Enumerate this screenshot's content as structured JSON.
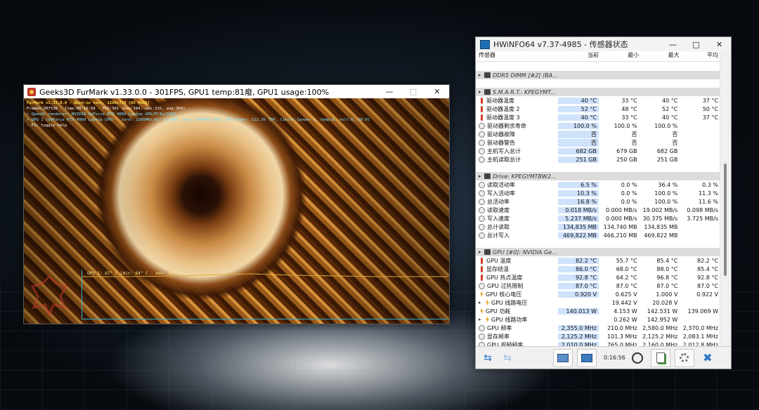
{
  "furmark": {
    "title": "Geeks3D FurMark v1.33.0.0 - 301FPS, GPU1 temp:81癈, GPU1 usage:100%",
    "osd_line1": "FurMark v1.33.0.0 - Burn-in test, 1280x720 (8X MSAA)",
    "osd_line2": "Frames:307538 - time:00:16:58 - FPS:301 (min:194, max:315, avg:304)",
    "osd_line3": "> OpenGL renderer: NVIDIA GeForce RTX 4060 Laptop GPU/PCIe/SSE2",
    "osd_line4": "> GPU 1 (GeForce RTX 4060 Laptop GPU) - core: 2205MHz/81° C/100%, mem: 8000MHz/96%, GPU power: 122.3% TDP, limits:[power:1, temp:0, volt:0, OV:0]",
    "osd_line5": "- F1: toggle help",
    "graph_label": "GPU 1: 81° C (min: 64° C - max: 85° C)"
  },
  "hwinfo": {
    "title": "HWiNFO64 v7.37-4985 - 传感器状态",
    "headers": {
      "sensor": "传感器",
      "current": "当前",
      "min": "最小",
      "max": "最大",
      "avg": "平均"
    },
    "groups": [
      {
        "label": "DDR5 DIMM [#2] (BA...",
        "rows": []
      },
      {
        "label": "S.M.A.R.T.: KPEGYMT...",
        "rows": [
          {
            "icon": "therm",
            "label": "驱动器温度",
            "cur": "40 °C",
            "min": "33 °C",
            "max": "40 °C",
            "avg": "37 °C"
          },
          {
            "icon": "therm",
            "label": "驱动器温度 2",
            "cur": "52 °C",
            "min": "48 °C",
            "max": "52 °C",
            "avg": "50 °C"
          },
          {
            "icon": "therm",
            "label": "驱动器温度 3",
            "cur": "40 °C",
            "min": "33 °C",
            "max": "40 °C",
            "avg": "37 °C"
          },
          {
            "icon": "circ",
            "label": "驱动器剩余寿命",
            "cur": "100.0 %",
            "min": "100.0 %",
            "max": "100.0 %",
            "avg": ""
          },
          {
            "icon": "circ",
            "label": "驱动器故障",
            "cur": "否",
            "min": "否",
            "max": "否",
            "avg": ""
          },
          {
            "icon": "circ",
            "label": "驱动器警告",
            "cur": "否",
            "min": "否",
            "max": "否",
            "avg": ""
          },
          {
            "icon": "circ",
            "label": "主机写入总计",
            "cur": "682 GB",
            "min": "679 GB",
            "max": "682 GB",
            "avg": ""
          },
          {
            "icon": "circ",
            "label": "主机读取总计",
            "cur": "251 GB",
            "min": "250 GB",
            "max": "251 GB",
            "avg": ""
          }
        ]
      },
      {
        "label": "Drive: KPEGYMTBW2...",
        "rows": [
          {
            "icon": "circ",
            "label": "读取活动率",
            "cur": "6.5 %",
            "min": "0.0 %",
            "max": "36.4 %",
            "avg": "0.3 %"
          },
          {
            "icon": "circ",
            "label": "写入活动率",
            "cur": "10.3 %",
            "min": "0.0 %",
            "max": "100.0 %",
            "avg": "11.3 %"
          },
          {
            "icon": "circ",
            "label": "总活动率",
            "cur": "16.8 %",
            "min": "0.0 %",
            "max": "100.0 %",
            "avg": "11.6 %"
          },
          {
            "icon": "circ",
            "label": "读取速度",
            "cur": "0.018 MB/s",
            "min": "0.000 MB/s",
            "max": "19.002 MB/s",
            "avg": "0.098 MB/s"
          },
          {
            "icon": "circ",
            "label": "写入速度",
            "cur": "5.237 MB/s",
            "min": "0.000 MB/s",
            "max": "30.375 MB/s",
            "avg": "3.725 MB/s"
          },
          {
            "icon": "circ",
            "label": "总计读取",
            "cur": "134,835 MB",
            "min": "134,740 MB",
            "max": "134,835 MB",
            "avg": ""
          },
          {
            "icon": "circ",
            "label": "总计写入",
            "cur": "469,822 MB",
            "min": "466,210 MB",
            "max": "469,822 MB",
            "avg": ""
          }
        ]
      },
      {
        "label": "GPU [#0]: NVIDIA Ge...",
        "rows": [
          {
            "icon": "therm",
            "label": "GPU 温度",
            "cur": "82.2 °C",
            "min": "55.7 °C",
            "max": "85.4 °C",
            "avg": "82.2 °C"
          },
          {
            "icon": "therm",
            "label": "显存结温",
            "cur": "86.0 °C",
            "min": "68.0 °C",
            "max": "88.0 °C",
            "avg": "85.4 °C"
          },
          {
            "icon": "therm",
            "label": "GPU 热点温度",
            "cur": "92.8 °C",
            "min": "64.2 °C",
            "max": "96.8 °C",
            "avg": "92.8 °C"
          },
          {
            "icon": "circ",
            "label": "GPU 过热限制",
            "cur": "87.0 °C",
            "min": "87.0 °C",
            "max": "87.0 °C",
            "avg": "87.0 °C"
          },
          {
            "icon": "bolt",
            "label": "GPU 核心电压",
            "cur": "0.920 V",
            "min": "0.625 V",
            "max": "1.000 V",
            "avg": "0.922 V"
          },
          {
            "icon": "bolt",
            "label": "GPU 线路电压",
            "cur": "",
            "min": "19.442 V",
            "max": "20.028 V",
            "avg": "",
            "expand": true
          },
          {
            "icon": "bolt",
            "label": "GPU 功耗",
            "cur": "140.013 W",
            "min": "4.153 W",
            "max": "142.531 W",
            "avg": "139.069 W"
          },
          {
            "icon": "bolt",
            "label": "GPU 线路功率",
            "cur": "",
            "min": "0.262 W",
            "max": "142.952 W",
            "avg": "",
            "expand": true
          },
          {
            "icon": "circ",
            "label": "GPU 频率",
            "cur": "2,355.0 MHz",
            "min": "210.0 MHz",
            "max": "2,580.0 MHz",
            "avg": "2,370.0 MHz"
          },
          {
            "icon": "circ",
            "label": "显存频率",
            "cur": "2,125.2 MHz",
            "min": "101.3 MHz",
            "max": "2,125.2 MHz",
            "avg": "2,083.1 MHz"
          },
          {
            "icon": "circ",
            "label": "GPU 视频频率",
            "cur": "2,010.0 MHz",
            "min": "765.0 MHz",
            "max": "2,160.0 MHz",
            "avg": "2,012.8 MHz"
          }
        ]
      }
    ],
    "timer": "0:16:56"
  }
}
